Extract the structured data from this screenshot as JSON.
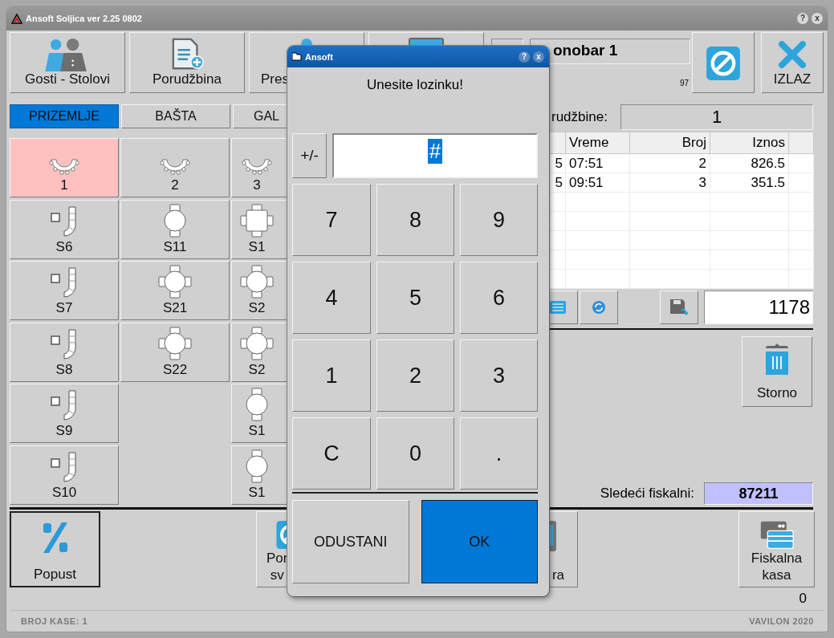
{
  "window": {
    "title": "Ansoft Soljica ver 2.25 0802",
    "title_buttons": [
      "?",
      "x"
    ]
  },
  "toolbar": {
    "buttons": [
      {
        "kind": "labeled",
        "label": "Gosti - Stolovi"
      },
      {
        "kind": "labeled",
        "label": "Porudžbina"
      },
      {
        "kind": "labeled",
        "label": "Pres"
      },
      {
        "kind": "icon_only"
      }
    ],
    "waiter": {
      "name": "onobar 1",
      "code": "97"
    },
    "exit_button": {
      "label": "IZLAZ"
    }
  },
  "area_tabs": [
    {
      "label": "PRIZEMLJE",
      "selected": true
    },
    {
      "label": "BAŠTA",
      "selected": false
    },
    {
      "label": "GAL",
      "selected": false
    }
  ],
  "table_columns": [
    [
      {
        "label": "1",
        "kind": "bow",
        "occupied": true
      },
      {
        "label": "S6",
        "kind": "booth",
        "occupied": false
      },
      {
        "label": "S7",
        "kind": "booth",
        "occupied": false
      },
      {
        "label": "S8",
        "kind": "booth",
        "occupied": false
      },
      {
        "label": "S9",
        "kind": "booth",
        "occupied": false
      },
      {
        "label": "S10",
        "kind": "booth",
        "occupied": false
      }
    ],
    [
      {
        "label": "2",
        "kind": "bow",
        "occupied": false
      },
      {
        "label": "S11",
        "kind": "round2",
        "occupied": false
      },
      {
        "label": "S21",
        "kind": "round4",
        "occupied": false
      },
      {
        "label": "S22",
        "kind": "round4",
        "occupied": false
      }
    ],
    [
      {
        "label": "3",
        "kind": "bow",
        "occupied": false
      },
      {
        "label": "S1",
        "kind": "square4",
        "occupied": false
      },
      {
        "label": "S2",
        "kind": "round4",
        "occupied": false
      },
      {
        "label": "S2",
        "kind": "round4",
        "occupied": false
      },
      {
        "label": "S1",
        "kind": "round2",
        "occupied": false
      },
      {
        "label": "S1",
        "kind": "round2",
        "occupied": false
      }
    ]
  ],
  "orders": {
    "label": "rudžbine:",
    "count": "1",
    "columns": [
      "Vreme",
      "Broj",
      "Iznos"
    ],
    "rows": [
      {
        "column_1": "5",
        "vreme": "07:51",
        "broj": "2",
        "iznos": "826.5"
      },
      {
        "column_1": "5",
        "vreme": "09:51",
        "broj": "3",
        "iznos": "351.5"
      }
    ],
    "total": "1178"
  },
  "storno_button": {
    "label": "Storno"
  },
  "fiscal": {
    "label": "Sledeći fiskalni:",
    "value": "87211"
  },
  "bottom_buttons": [
    {
      "label": "Popust",
      "focused": true
    },
    {
      "label": "Por\nsv",
      "focused": false
    },
    {
      "label": "ra",
      "focused": false
    },
    {
      "label": "Fiskalna kasa",
      "focused": false
    }
  ],
  "counter": "0",
  "status_bar": {
    "left": "BROJ KASE: 1",
    "right": "VAVILON 2020"
  },
  "dialog": {
    "title": "Ansoft",
    "title_buttons": [
      "?",
      "x"
    ],
    "prompt": "Unesite lozinku!",
    "sign_key": "+/-",
    "password": {
      "value": "#",
      "selected": true
    },
    "keys": [
      "7",
      "8",
      "9",
      "4",
      "5",
      "6",
      "1",
      "2",
      "3",
      "C",
      "0",
      "."
    ],
    "buttons": [
      {
        "label": "ODUSTANI",
        "selected": false
      },
      {
        "label": "OK",
        "selected": true
      }
    ]
  }
}
